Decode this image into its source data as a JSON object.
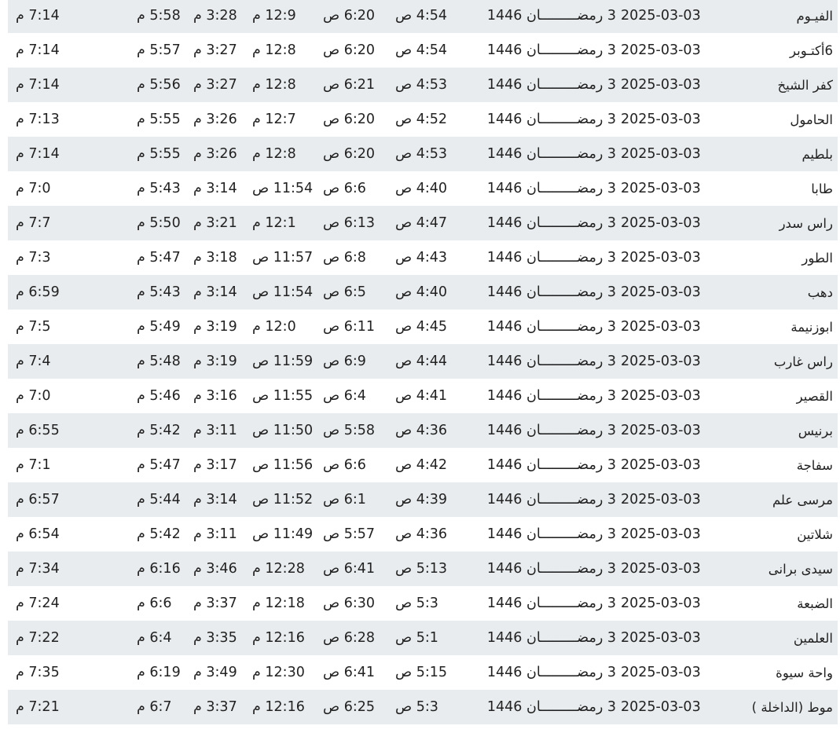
{
  "table": {
    "rows": [
      {
        "city": "الفيـوم",
        "greg": "2025-03-03",
        "hijri": "3 رمضـــــــــان 1446",
        "fajr": "4:54 ص",
        "sunrise": "6:20 ص",
        "dhuhr": "12:9 م",
        "asr": "3:28 م",
        "maghrib": "5:58 م",
        "isha": "7:14 م"
      },
      {
        "city": "6أكتـوبر",
        "greg": "2025-03-03",
        "hijri": "3 رمضـــــــــان 1446",
        "fajr": "4:54 ص",
        "sunrise": "6:20 ص",
        "dhuhr": "12:8 م",
        "asr": "3:27 م",
        "maghrib": "5:57 م",
        "isha": "7:14 م"
      },
      {
        "city": "كفر الشيخ",
        "greg": "2025-03-03",
        "hijri": "3 رمضـــــــــان 1446",
        "fajr": "4:53 ص",
        "sunrise": "6:21 ص",
        "dhuhr": "12:8 م",
        "asr": "3:27 م",
        "maghrib": "5:56 م",
        "isha": "7:14 م"
      },
      {
        "city": "الحامول",
        "greg": "2025-03-03",
        "hijri": "3 رمضـــــــــان 1446",
        "fajr": "4:52 ص",
        "sunrise": "6:20 ص",
        "dhuhr": "12:7 م",
        "asr": "3:26 م",
        "maghrib": "5:55 م",
        "isha": "7:13 م"
      },
      {
        "city": "بلطيم",
        "greg": "2025-03-03",
        "hijri": "3 رمضـــــــــان 1446",
        "fajr": "4:53 ص",
        "sunrise": "6:20 ص",
        "dhuhr": "12:8 م",
        "asr": "3:26 م",
        "maghrib": "5:55 م",
        "isha": "7:14 م"
      },
      {
        "city": "طابا",
        "greg": "2025-03-03",
        "hijri": "3 رمضـــــــــان 1446",
        "fajr": "4:40 ص",
        "sunrise": "6:6 ص",
        "dhuhr": "11:54 ص",
        "asr": "3:14 م",
        "maghrib": "5:43 م",
        "isha": "7:0 م"
      },
      {
        "city": "راس سدر",
        "greg": "2025-03-03",
        "hijri": "3 رمضـــــــــان 1446",
        "fajr": "4:47 ص",
        "sunrise": "6:13 ص",
        "dhuhr": "12:1 م",
        "asr": "3:21 م",
        "maghrib": "5:50 م",
        "isha": "7:7 م"
      },
      {
        "city": "الطور",
        "greg": "2025-03-03",
        "hijri": "3 رمضـــــــــان 1446",
        "fajr": "4:43 ص",
        "sunrise": "6:8 ص",
        "dhuhr": "11:57 ص",
        "asr": "3:18 م",
        "maghrib": "5:47 م",
        "isha": "7:3 م"
      },
      {
        "city": "دهب",
        "greg": "2025-03-03",
        "hijri": "3 رمضـــــــــان 1446",
        "fajr": "4:40 ص",
        "sunrise": "6:5 ص",
        "dhuhr": "11:54 ص",
        "asr": "3:14 م",
        "maghrib": "5:43 م",
        "isha": "6:59 م"
      },
      {
        "city": "ابوزنيمة",
        "greg": "2025-03-03",
        "hijri": "3 رمضـــــــــان 1446",
        "fajr": "4:45 ص",
        "sunrise": "6:11 ص",
        "dhuhr": "12:0 م",
        "asr": "3:19 م",
        "maghrib": "5:49 م",
        "isha": "7:5 م"
      },
      {
        "city": "راس غارب",
        "greg": "2025-03-03",
        "hijri": "3 رمضـــــــــان 1446",
        "fajr": "4:44 ص",
        "sunrise": "6:9 ص",
        "dhuhr": "11:59 ص",
        "asr": "3:19 م",
        "maghrib": "5:48 م",
        "isha": "7:4 م"
      },
      {
        "city": "القصير",
        "greg": "2025-03-03",
        "hijri": "3 رمضـــــــــان 1446",
        "fajr": "4:41 ص",
        "sunrise": "6:4 ص",
        "dhuhr": "11:55 ص",
        "asr": "3:16 م",
        "maghrib": "5:46 م",
        "isha": "7:0 م"
      },
      {
        "city": "برنيس",
        "greg": "2025-03-03",
        "hijri": "3 رمضـــــــــان 1446",
        "fajr": "4:36 ص",
        "sunrise": "5:58 ص",
        "dhuhr": "11:50 ص",
        "asr": "3:11 م",
        "maghrib": "5:42 م",
        "isha": "6:55 م"
      },
      {
        "city": "سفاجة",
        "greg": "2025-03-03",
        "hijri": "3 رمضـــــــــان 1446",
        "fajr": "4:42 ص",
        "sunrise": "6:6 ص",
        "dhuhr": "11:56 ص",
        "asr": "3:17 م",
        "maghrib": "5:47 م",
        "isha": "7:1 م"
      },
      {
        "city": "مرسى علم",
        "greg": "2025-03-03",
        "hijri": "3 رمضـــــــــان 1446",
        "fajr": "4:39 ص",
        "sunrise": "6:1 ص",
        "dhuhr": "11:52 ص",
        "asr": "3:14 م",
        "maghrib": "5:44 م",
        "isha": "6:57 م"
      },
      {
        "city": "شلاتين",
        "greg": "2025-03-03",
        "hijri": "3 رمضـــــــــان 1446",
        "fajr": "4:36 ص",
        "sunrise": "5:57 ص",
        "dhuhr": "11:49 ص",
        "asr": "3:11 م",
        "maghrib": "5:42 م",
        "isha": "6:54 م"
      },
      {
        "city": "سيدى برانى",
        "greg": "2025-03-03",
        "hijri": "3 رمضـــــــــان 1446",
        "fajr": "5:13 ص",
        "sunrise": "6:41 ص",
        "dhuhr": "12:28 م",
        "asr": "3:46 م",
        "maghrib": "6:16 م",
        "isha": "7:34 م"
      },
      {
        "city": "الضبعة",
        "greg": "2025-03-03",
        "hijri": "3 رمضـــــــــان 1446",
        "fajr": "5:3 ص",
        "sunrise": "6:30 ص",
        "dhuhr": "12:18 م",
        "asr": "3:37 م",
        "maghrib": "6:6 م",
        "isha": "7:24 م"
      },
      {
        "city": "العلمين",
        "greg": "2025-03-03",
        "hijri": "3 رمضـــــــــان 1446",
        "fajr": "5:1 ص",
        "sunrise": "6:28 ص",
        "dhuhr": "12:16 م",
        "asr": "3:35 م",
        "maghrib": "6:4 م",
        "isha": "7:22 م"
      },
      {
        "city": "واحة سيوة",
        "greg": "2025-03-03",
        "hijri": "3 رمضـــــــــان 1446",
        "fajr": "5:15 ص",
        "sunrise": "6:41 ص",
        "dhuhr": "12:30 م",
        "asr": "3:49 م",
        "maghrib": "6:19 م",
        "isha": "7:35 م"
      },
      {
        "city": "موط (الداخلة )",
        "greg": "2025-03-03",
        "hijri": "3 رمضـــــــــان 1446",
        "fajr": "5:3 ص",
        "sunrise": "6:25 ص",
        "dhuhr": "12:16 م",
        "asr": "3:37 م",
        "maghrib": "6:7 م",
        "isha": "7:21 م"
      }
    ],
    "colors": {
      "stripe": "#e8ecee",
      "text": "#222222"
    }
  }
}
